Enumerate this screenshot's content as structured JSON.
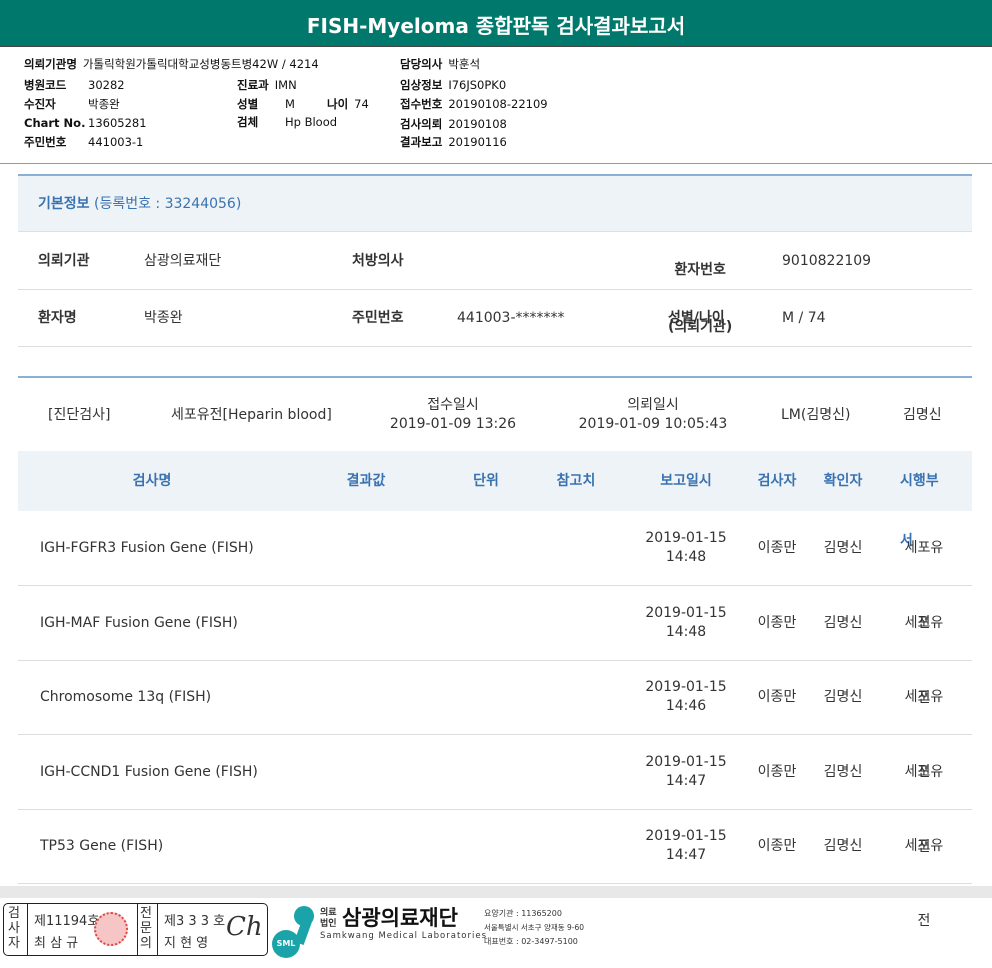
{
  "title": "FISH-Myeloma 종합판독 검사결과보고서",
  "info": {
    "inst_label": "의뢰기관명",
    "inst": "가톨릭학원가톨릭대학교성병동트병42W / 4214",
    "doctor_label": "담당의사",
    "doctor": "박훈석",
    "hcode_label": "병원코드",
    "hcode": "30282",
    "dept_label": "진료과",
    "dept": "IMN",
    "clin_label": "임상정보",
    "clin": "I76JS0PK0",
    "patient_label": "수진자",
    "patient": "박종완",
    "sex_label": "성별",
    "sex": "M",
    "age_label": "나이",
    "age": "74",
    "rcpt_label": "접수번호",
    "rcpt": "20190108-22109",
    "chart_label": "Chart No.",
    "chart": "13605281",
    "spec_label": "검체",
    "spec": "Hp Blood",
    "req_label": "검사의뢰",
    "req": "20190108",
    "rrn_label": "주민번호",
    "rrn": "441003-1",
    "report_label": "결과보고",
    "report": "20190116"
  },
  "basic": {
    "title": "기본정보",
    "reg": "(등록번호 : 33244056)",
    "inst_label": "의뢰기관",
    "inst": "삼광의료재단",
    "presc_label": "처방의사",
    "presc": "",
    "pno_label1": "환자번호",
    "pno_label2": "(의뢰기관)",
    "pno": "9010822109",
    "name_label": "환자명",
    "name": "박종완",
    "rrn_label": "주민번호",
    "rrn": "441003-*******",
    "sexage_label": "성별/나이",
    "sexage": "M / 74"
  },
  "diag": {
    "type": "[진단검사]",
    "dept": "세포유전[Heparin blood]",
    "rcpt_label": "접수일시",
    "rcpt": "2019-01-09 13:26",
    "req_label": "의뢰일시",
    "req": "2019-01-09 10:05:43",
    "lm": "LM(김명신)",
    "signer": "김명신"
  },
  "table": {
    "headers": [
      "검사명",
      "결과값",
      "단위",
      "참고치",
      "보고일시",
      "검사자",
      "확인자",
      "시행부서"
    ],
    "rows": [
      {
        "name": "IGH-FGFR3 Fusion Gene (FISH)",
        "date": "2019-01-15",
        "time": "14:48",
        "tester": "이종만",
        "checker": "김명신",
        "dept": "세포유전"
      },
      {
        "name": "IGH-MAF Fusion Gene (FISH)",
        "date": "2019-01-15",
        "time": "14:48",
        "tester": "이종만",
        "checker": "김명신",
        "dept": "세포유전"
      },
      {
        "name": "Chromosome 13q (FISH)",
        "date": "2019-01-15",
        "time": "14:46",
        "tester": "이종만",
        "checker": "김명신",
        "dept": "세포유전"
      },
      {
        "name": "IGH-CCND1 Fusion Gene (FISH)",
        "date": "2019-01-15",
        "time": "14:47",
        "tester": "이종만",
        "checker": "김명신",
        "dept": "세포유전"
      },
      {
        "name": "TP53 Gene (FISH)",
        "date": "2019-01-15",
        "time": "14:47",
        "tester": "이종만",
        "checker": "김명신",
        "dept": "세포유전"
      }
    ]
  },
  "footer": {
    "tester_label": "검사자",
    "tester_no": "제11194호",
    "tester_name": "최 삼 규",
    "spec_label": "전문의",
    "spec_no": "제3 3 3 호",
    "spec_name": "지 현 영",
    "org_prefix": "의료법인",
    "org": "삼광의료재단",
    "org_en": "Samkwang Medical Laboratories",
    "logo": "SML",
    "code": "요양기관 : 11365200",
    "addr": "서울특별시 서초구 양재동 9-60",
    "tel": "대표번호 : 02-3497-5100"
  }
}
